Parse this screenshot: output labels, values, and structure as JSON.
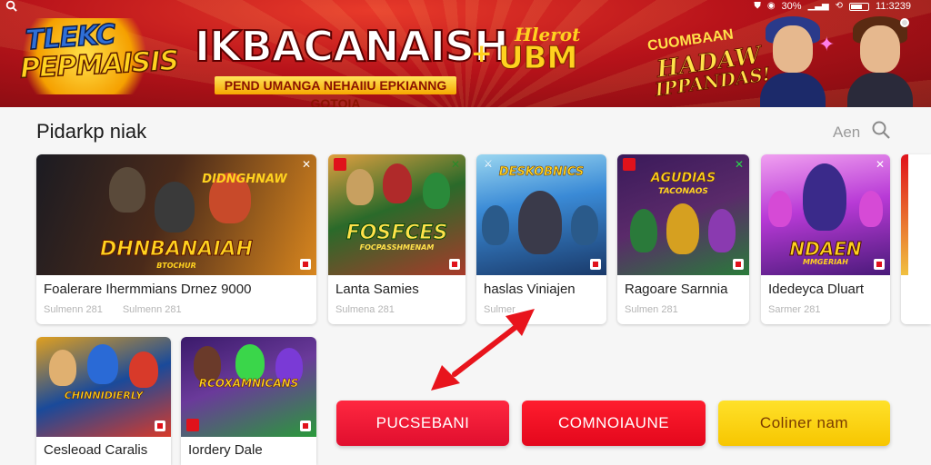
{
  "status_bar": {
    "time": "11:3239",
    "signal": "30%"
  },
  "banner": {
    "logo_line1": "TLEKC",
    "logo_line2": "PEPMAISIS",
    "title": "IKBACANAISH",
    "plus": "+",
    "small_label": "Hlerot",
    "big_label": "UBM",
    "subtitle": "PEND UMANGA NEHAIIU EPKIANNG GOTOIA",
    "promo_line1": "CUOMBAAN",
    "promo_line2": "HADAW",
    "promo_line3": "IPPANDAS!"
  },
  "section": {
    "title": "Pidarkp niak",
    "see_all": "Aen"
  },
  "cards": [
    {
      "thumb_title": "DHNBANAIAH",
      "thumb_sub": "BTOCHUR",
      "top_title": "DIDNGHNAW",
      "name": "Foalerare Ihermmians Drnez 9000",
      "meta1": "Sulmenn 281",
      "meta2": "Sulmenn 281",
      "colors": [
        "#1b1b22",
        "#6b3b1b",
        "#d8861e"
      ]
    },
    {
      "thumb_title": "FOSFCES",
      "thumb_sub": "FOCPASSHMENAM",
      "top_title": "",
      "name": "Lanta Samies",
      "meta1": "Sulmena 281",
      "meta2": "",
      "colors": [
        "#2a6a2a",
        "#a83a2a",
        "#e8c858"
      ]
    },
    {
      "thumb_title": "DESKOBNICS",
      "thumb_sub": "",
      "top_title": "",
      "name": "haslas Viniajen",
      "meta1": "Sulmer",
      "meta2": "",
      "colors": [
        "#1a3a6a",
        "#3a8ad6",
        "#9ad6f0"
      ]
    },
    {
      "thumb_title": "AGUDIAS",
      "thumb_sub": "TACONAOS",
      "top_title": "",
      "name": "Ragoare Sarnnia",
      "meta1": "Sulmen 281",
      "meta2": "",
      "colors": [
        "#3a1a5a",
        "#2a7a3a",
        "#e0a020"
      ]
    },
    {
      "thumb_title": "NDAEN",
      "thumb_sub": "MMGERIAH",
      "top_title": "",
      "name": "Idedeyca Dluart",
      "meta1": "Sarmer 281",
      "meta2": "",
      "colors": [
        "#4a1a7a",
        "#b83ad6",
        "#f0a0f0"
      ]
    },
    {
      "thumb_title": "CHINNIDIERLY",
      "thumb_sub": "",
      "top_title": "",
      "name": "Cesleoad Caralis",
      "meta1": "",
      "meta2": "",
      "colors": [
        "#1a4a9a",
        "#e0a020",
        "#d83a2a"
      ]
    },
    {
      "thumb_title": "RCOXAMNICANS",
      "thumb_sub": "",
      "top_title": "",
      "name": "Iordery Dale",
      "meta1": "",
      "meta2": "",
      "colors": [
        "#3a1a6a",
        "#e0b020",
        "#2a9a3a"
      ]
    }
  ],
  "buttons": {
    "primary": "PUCSEBANI",
    "secondary": "COMNOIAUNE",
    "tertiary": "Coliner nam"
  },
  "colors": {
    "brand_red": "#e0121b",
    "banner_red": "#b8131a",
    "yellow": "#ffd21f",
    "arrow_red": "#e8141c"
  }
}
